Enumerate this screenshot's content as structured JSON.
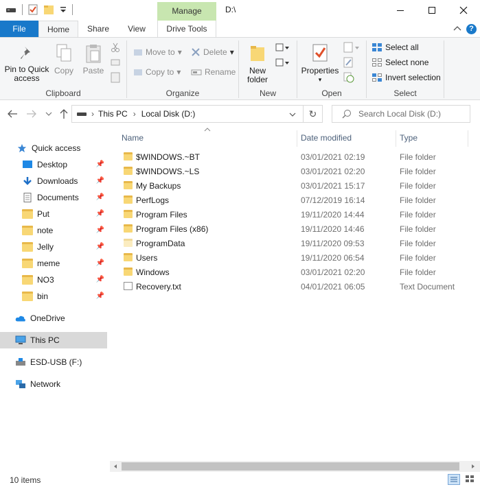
{
  "window": {
    "title": "D:\\",
    "manage_tab": "Manage"
  },
  "ribbon_tabs": {
    "file": "File",
    "home": "Home",
    "share": "Share",
    "view": "View",
    "drive_tools": "Drive Tools"
  },
  "ribbon": {
    "clipboard": {
      "label": "Clipboard",
      "pin": "Pin to Quick access",
      "copy": "Copy",
      "paste": "Paste"
    },
    "organize": {
      "label": "Organize",
      "move_to": "Move to",
      "copy_to": "Copy to",
      "delete": "Delete",
      "rename": "Rename"
    },
    "new": {
      "label": "New",
      "new_folder": "New folder"
    },
    "open": {
      "label": "Open",
      "properties": "Properties"
    },
    "select": {
      "label": "Select",
      "select_all": "Select all",
      "select_none": "Select none",
      "invert": "Invert selection"
    }
  },
  "address": {
    "crumb_1": "This PC",
    "crumb_2": "Local Disk (D:)",
    "search_placeholder": "Search Local Disk (D:)"
  },
  "nav": {
    "quick_access": "Quick access",
    "desktop": "Desktop",
    "downloads": "Downloads",
    "documents": "Documents",
    "put": "Put",
    "note": "note",
    "jelly": "Jelly",
    "meme": "meme",
    "no3": "NO3",
    "bin": "bin",
    "onedrive": "OneDrive",
    "this_pc": "This PC",
    "esd_usb": "ESD-USB (F:)",
    "network": "Network"
  },
  "columns": {
    "name": "Name",
    "date": "Date modified",
    "type": "Type"
  },
  "files": [
    {
      "name": "$WINDOWS.~BT",
      "date": "03/01/2021 02:19",
      "type": "File folder",
      "icon": "folder"
    },
    {
      "name": "$WINDOWS.~LS",
      "date": "03/01/2021 02:20",
      "type": "File folder",
      "icon": "folder"
    },
    {
      "name": "My Backups",
      "date": "03/01/2021 15:17",
      "type": "File folder",
      "icon": "folder"
    },
    {
      "name": "PerfLogs",
      "date": "07/12/2019 16:14",
      "type": "File folder",
      "icon": "folder"
    },
    {
      "name": "Program Files",
      "date": "19/11/2020 14:44",
      "type": "File folder",
      "icon": "folder"
    },
    {
      "name": "Program Files (x86)",
      "date": "19/11/2020 14:46",
      "type": "File folder",
      "icon": "folder"
    },
    {
      "name": "ProgramData",
      "date": "19/11/2020 09:53",
      "type": "File folder",
      "icon": "folder-hidden"
    },
    {
      "name": "Users",
      "date": "19/11/2020 06:54",
      "type": "File folder",
      "icon": "folder"
    },
    {
      "name": "Windows",
      "date": "03/01/2021 02:20",
      "type": "File folder",
      "icon": "folder"
    },
    {
      "name": "Recovery.txt",
      "date": "04/01/2021 06:05",
      "type": "Text Document",
      "icon": "text-file"
    }
  ],
  "status": {
    "item_count": "10 items"
  },
  "colors": {
    "accent": "#1979ca",
    "manage_tab": "#c8e6b0",
    "folder": "#f8d775",
    "selected_nav": "#d9d9d9"
  }
}
